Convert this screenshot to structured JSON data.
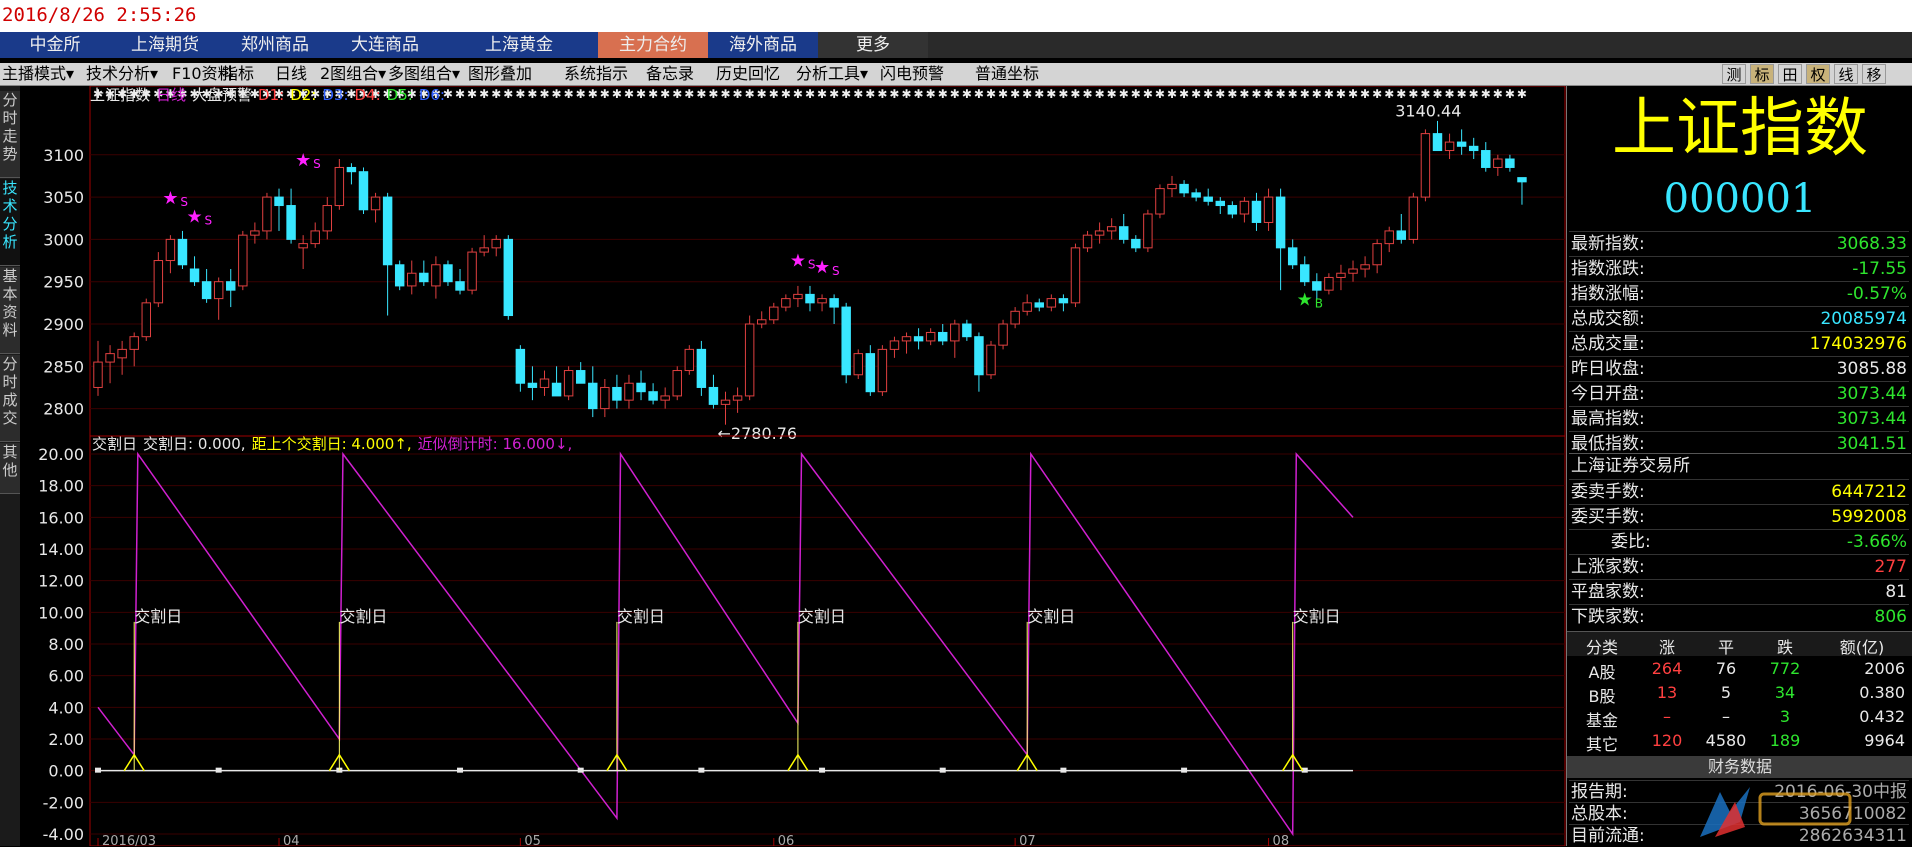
{
  "timestamp": "2016/8/26  2:55:26",
  "exchange_tabs": [
    "中金所",
    "上海期货",
    "郑州商品",
    "大连商品",
    "上海黄金",
    "主力合约",
    "海外商品",
    "更多"
  ],
  "toolbar": [
    "主播模式▾",
    "技术分析▾",
    "F10资料",
    "指标",
    "日线",
    "2图组合▾",
    "多图组合▾",
    "图形叠加",
    "系统指示",
    "备忘录",
    "历史回忆",
    "分析工具▾",
    "闪电预警",
    "普通坐标"
  ],
  "toolbar_right": [
    "测",
    "标",
    "田",
    "权",
    "线",
    "移"
  ],
  "sidebar": [
    "分时走势",
    "技术分析",
    "基本资料",
    "分时成交",
    "其他"
  ],
  "colors": {
    "up": "#e04040",
    "down": "#39e6ff",
    "yellow": "#ffff00",
    "magenta": "#d020d0",
    "green": "#2ee52e",
    "label": "#e8e8e8"
  },
  "legend_main": [
    {
      "t": "上证指数",
      "c": "#e8e8e8"
    },
    {
      "t": "日线",
      "c": "#d020d0"
    },
    {
      "t": "大盘预警",
      "c": "#e8e8e8"
    },
    {
      "t": "D1:",
      "c": "#ff4040"
    },
    {
      "t": "D2:",
      "c": "#ffff00"
    },
    {
      "t": "D3:",
      "c": "#3060ff"
    },
    {
      "t": "D4:",
      "c": "#ff4040"
    },
    {
      "t": "D5:",
      "c": "#2ee52e"
    },
    {
      "t": "D6:",
      "c": "#3060ff"
    }
  ],
  "legend_sub": [
    {
      "t": "交割日",
      "c": "#e8e8e8"
    },
    {
      "t": "交割日: 0.000,",
      "c": "#e8e8e8"
    },
    {
      "t": "距上个交割日: 4.000↑,",
      "c": "#ffff00"
    },
    {
      "t": "近似倒计时: 16.000↓,",
      "c": "#d020d0"
    }
  ],
  "chart_data": [
    {
      "type": "candlestick",
      "title": "上证指数 日线",
      "ylim": [
        2770,
        3160
      ],
      "yticks": [
        2800,
        2850,
        2900,
        2950,
        3000,
        3050,
        3100
      ],
      "xticks": [
        {
          "i": 0,
          "label": "2016/03"
        },
        {
          "i": 15,
          "label": "04"
        },
        {
          "i": 35,
          "label": "05"
        },
        {
          "i": 56,
          "label": "06"
        },
        {
          "i": 76,
          "label": "07"
        },
        {
          "i": 97,
          "label": "08"
        }
      ],
      "annotations": [
        {
          "text": "3140.44",
          "i": 107,
          "y": 3140.44
        },
        {
          "text": "←2780.76",
          "i": 52,
          "y": 2780.76
        }
      ],
      "signals": [
        {
          "i": 6,
          "y": 3042,
          "label": "S",
          "color": "#ff20ff"
        },
        {
          "i": 8,
          "y": 3020,
          "label": "S",
          "color": "#ff20ff"
        },
        {
          "i": 17,
          "y": 3087,
          "label": "S",
          "color": "#ff20ff"
        },
        {
          "i": 58,
          "y": 2968,
          "label": "S",
          "color": "#ff20ff"
        },
        {
          "i": 60,
          "y": 2960,
          "label": "S",
          "color": "#ff20ff"
        },
        {
          "i": 100,
          "y": 2922,
          "label": "B",
          "color": "#2ee52e"
        }
      ],
      "ohlc": [
        [
          2825,
          2880,
          2815,
          2855
        ],
        [
          2855,
          2875,
          2830,
          2865
        ],
        [
          2860,
          2880,
          2840,
          2870
        ],
        [
          2870,
          2890,
          2850,
          2885
        ],
        [
          2885,
          2930,
          2880,
          2925
        ],
        [
          2925,
          2985,
          2920,
          2975
        ],
        [
          2975,
          3005,
          2960,
          3000
        ],
        [
          3000,
          3010,
          2965,
          2970
        ],
        [
          2965,
          2980,
          2945,
          2950
        ],
        [
          2950,
          2965,
          2925,
          2930
        ],
        [
          2930,
          2955,
          2905,
          2950
        ],
        [
          2950,
          2965,
          2920,
          2940
        ],
        [
          2945,
          3010,
          2940,
          3005
        ],
        [
          3005,
          3020,
          2995,
          3010
        ],
        [
          3010,
          3055,
          3000,
          3050
        ],
        [
          3050,
          3060,
          3010,
          3040
        ],
        [
          3040,
          3060,
          2995,
          3000
        ],
        [
          2990,
          3005,
          2965,
          2995
        ],
        [
          2995,
          3020,
          2990,
          3010
        ],
        [
          3010,
          3050,
          3000,
          3040
        ],
        [
          3040,
          3095,
          3035,
          3085
        ],
        [
          3085,
          3090,
          3065,
          3080
        ],
        [
          3080,
          3085,
          3030,
          3035
        ],
        [
          3035,
          3055,
          3020,
          3050
        ],
        [
          3050,
          3055,
          2910,
          2970
        ],
        [
          2970,
          2975,
          2940,
          2945
        ],
        [
          2945,
          2975,
          2935,
          2960
        ],
        [
          2960,
          2975,
          2945,
          2950
        ],
        [
          2945,
          2980,
          2930,
          2970
        ],
        [
          2970,
          2975,
          2945,
          2950
        ],
        [
          2950,
          2965,
          2935,
          2940
        ],
        [
          2940,
          2990,
          2935,
          2985
        ],
        [
          2985,
          3005,
          2980,
          2990
        ],
        [
          2990,
          3005,
          2980,
          3000
        ],
        [
          3000,
          3005,
          2905,
          2910
        ],
        [
          2870,
          2875,
          2820,
          2830
        ],
        [
          2830,
          2850,
          2810,
          2825
        ],
        [
          2825,
          2845,
          2815,
          2835
        ],
        [
          2830,
          2850,
          2815,
          2815
        ],
        [
          2815,
          2850,
          2810,
          2845
        ],
        [
          2845,
          2855,
          2830,
          2830
        ],
        [
          2830,
          2850,
          2790,
          2800
        ],
        [
          2800,
          2835,
          2790,
          2825
        ],
        [
          2825,
          2840,
          2800,
          2810
        ],
        [
          2810,
          2840,
          2800,
          2830
        ],
        [
          2830,
          2845,
          2810,
          2820
        ],
        [
          2820,
          2830,
          2805,
          2810
        ],
        [
          2810,
          2825,
          2800,
          2815
        ],
        [
          2815,
          2850,
          2810,
          2845
        ],
        [
          2845,
          2875,
          2840,
          2870
        ],
        [
          2870,
          2880,
          2815,
          2825
        ],
        [
          2825,
          2840,
          2800,
          2805
        ],
        [
          2805,
          2820,
          2781,
          2810
        ],
        [
          2810,
          2825,
          2795,
          2815
        ],
        [
          2815,
          2910,
          2810,
          2900
        ],
        [
          2900,
          2915,
          2895,
          2905
        ],
        [
          2905,
          2925,
          2900,
          2920
        ],
        [
          2920,
          2935,
          2915,
          2930
        ],
        [
          2930,
          2945,
          2920,
          2935
        ],
        [
          2935,
          2945,
          2915,
          2925
        ],
        [
          2925,
          2935,
          2915,
          2930
        ],
        [
          2930,
          2935,
          2900,
          2920
        ],
        [
          2920,
          2925,
          2830,
          2840
        ],
        [
          2840,
          2870,
          2835,
          2865
        ],
        [
          2865,
          2875,
          2815,
          2820
        ],
        [
          2820,
          2875,
          2815,
          2870
        ],
        [
          2870,
          2885,
          2860,
          2880
        ],
        [
          2880,
          2890,
          2865,
          2885
        ],
        [
          2885,
          2895,
          2870,
          2880
        ],
        [
          2880,
          2895,
          2875,
          2890
        ],
        [
          2890,
          2900,
          2875,
          2880
        ],
        [
          2880,
          2905,
          2860,
          2900
        ],
        [
          2900,
          2905,
          2880,
          2885
        ],
        [
          2885,
          2890,
          2820,
          2840
        ],
        [
          2840,
          2880,
          2835,
          2875
        ],
        [
          2875,
          2905,
          2870,
          2900
        ],
        [
          2900,
          2920,
          2895,
          2915
        ],
        [
          2915,
          2935,
          2910,
          2925
        ],
        [
          2925,
          2930,
          2915,
          2920
        ],
        [
          2920,
          2935,
          2915,
          2930
        ],
        [
          2930,
          2935,
          2915,
          2925
        ],
        [
          2925,
          2995,
          2920,
          2990
        ],
        [
          2990,
          3010,
          2985,
          3005
        ],
        [
          3005,
          3020,
          2995,
          3010
        ],
        [
          3010,
          3025,
          3000,
          3015
        ],
        [
          3015,
          3030,
          2995,
          3000
        ],
        [
          3000,
          3005,
          2985,
          2990
        ],
        [
          2990,
          3035,
          2985,
          3030
        ],
        [
          3030,
          3065,
          3025,
          3060
        ],
        [
          3060,
          3075,
          3050,
          3065
        ],
        [
          3065,
          3070,
          3050,
          3055
        ],
        [
          3055,
          3060,
          3045,
          3050
        ],
        [
          3050,
          3060,
          3040,
          3045
        ],
        [
          3045,
          3050,
          3030,
          3040
        ],
        [
          3040,
          3045,
          3025,
          3030
        ],
        [
          3030,
          3050,
          3020,
          3045
        ],
        [
          3045,
          3055,
          3010,
          3020
        ],
        [
          3020,
          3060,
          3010,
          3050
        ],
        [
          3050,
          3060,
          2940,
          2990
        ],
        [
          2990,
          3000,
          2965,
          2970
        ],
        [
          2970,
          2980,
          2945,
          2950
        ],
        [
          2950,
          2960,
          2930,
          2940
        ],
        [
          2940,
          2960,
          2935,
          2955
        ],
        [
          2955,
          2970,
          2940,
          2960
        ],
        [
          2960,
          2975,
          2950,
          2965
        ],
        [
          2965,
          2980,
          2955,
          2970
        ],
        [
          2970,
          3000,
          2960,
          2995
        ],
        [
          2995,
          3015,
          2985,
          3010
        ],
        [
          3010,
          3030,
          2995,
          3000
        ],
        [
          3000,
          3055,
          2995,
          3050
        ],
        [
          3050,
          3130,
          3045,
          3125
        ],
        [
          3125,
          3140,
          3105,
          3105
        ],
        [
          3105,
          3125,
          3095,
          3115
        ],
        [
          3115,
          3130,
          3100,
          3110
        ],
        [
          3110,
          3120,
          3095,
          3105
        ],
        [
          3105,
          3115,
          3080,
          3085
        ],
        [
          3085,
          3100,
          3075,
          3095
        ],
        [
          3095,
          3100,
          3080,
          3085
        ],
        [
          3073,
          3073,
          3041,
          3068
        ]
      ]
    },
    {
      "type": "line",
      "title": "交割日",
      "ylim": [
        -4,
        20
      ],
      "yticks": [
        -4.0,
        -2.0,
        0.0,
        2.0,
        4.0,
        6.0,
        8.0,
        10.0,
        12.0,
        14.0,
        16.0,
        18.0,
        20.0
      ],
      "series": [
        {
          "name": "近似倒计时",
          "color": "#d020d0",
          "peaks": [
            {
              "i": 3,
              "y": 1
            },
            {
              "i": 20,
              "y": 2
            },
            {
              "i": 43,
              "y": -3
            },
            {
              "i": 58,
              "y": 3
            },
            {
              "i": 77,
              "y": 1
            },
            {
              "i": 99,
              "y": -4
            }
          ],
          "end": {
            "i": 104,
            "y": 16
          }
        }
      ],
      "delivery_days": [
        3,
        20,
        43,
        58,
        77,
        99
      ],
      "delivery_label": "交割日",
      "square_marks": [
        0,
        10,
        20,
        30,
        40,
        50,
        60,
        70,
        80,
        90,
        100
      ]
    }
  ],
  "quote": {
    "name": "上证指数",
    "code": "000001",
    "rows": [
      {
        "label": "最新指数:",
        "value": "3068.33",
        "color": "#2ee52e"
      },
      {
        "label": "指数涨跌:",
        "value": "-17.55",
        "color": "#2ee52e"
      },
      {
        "label": "指数涨幅:",
        "value": "-0.57%",
        "color": "#2ee52e"
      },
      {
        "label": "总成交额:",
        "value": "20085974",
        "color": "#39e6ff"
      },
      {
        "label": "总成交量:",
        "value": "174032976",
        "color": "#ffff00"
      },
      {
        "label": "昨日收盘:",
        "value": "3085.88",
        "color": "#e8e8e8"
      },
      {
        "label": "今日开盘:",
        "value": "3073.44",
        "color": "#2ee52e"
      },
      {
        "label": "最高指数:",
        "value": "3073.44",
        "color": "#2ee52e"
      },
      {
        "label": "最低指数:",
        "value": "3041.51",
        "color": "#2ee52e"
      }
    ],
    "exchange": "上海证券交易所",
    "rows2": [
      {
        "label": "委卖手数:",
        "value": "6447212",
        "color": "#ffff00"
      },
      {
        "label": "委买手数:",
        "value": "5992008",
        "color": "#ffff00"
      },
      {
        "label": "委比:",
        "value": "-3.66%",
        "color": "#2ee52e"
      },
      {
        "label": "上涨家数:",
        "value": "277",
        "color": "#ff4040"
      },
      {
        "label": "平盘家数:",
        "value": "81",
        "color": "#e8e8e8"
      },
      {
        "label": "下跌家数:",
        "value": "806",
        "color": "#2ee52e"
      }
    ],
    "table_head": [
      "分类",
      "涨",
      "平",
      "跌",
      "额(亿)"
    ],
    "table": [
      [
        "A股",
        "264",
        "76",
        "772",
        "2006"
      ],
      [
        "B股",
        "13",
        "5",
        "34",
        "0.380"
      ],
      [
        "基金",
        "–",
        "–",
        "3",
        "0.432"
      ],
      [
        "其它",
        "120",
        "4580",
        "189",
        "9964"
      ]
    ],
    "finance_header": "财务数据",
    "finance": [
      {
        "label": "报告期:",
        "value": "2016-06-30中报"
      },
      {
        "label": "总股本:",
        "value": "3656710082"
      },
      {
        "label": "目前流通:",
        "value": "2862634311"
      }
    ]
  }
}
